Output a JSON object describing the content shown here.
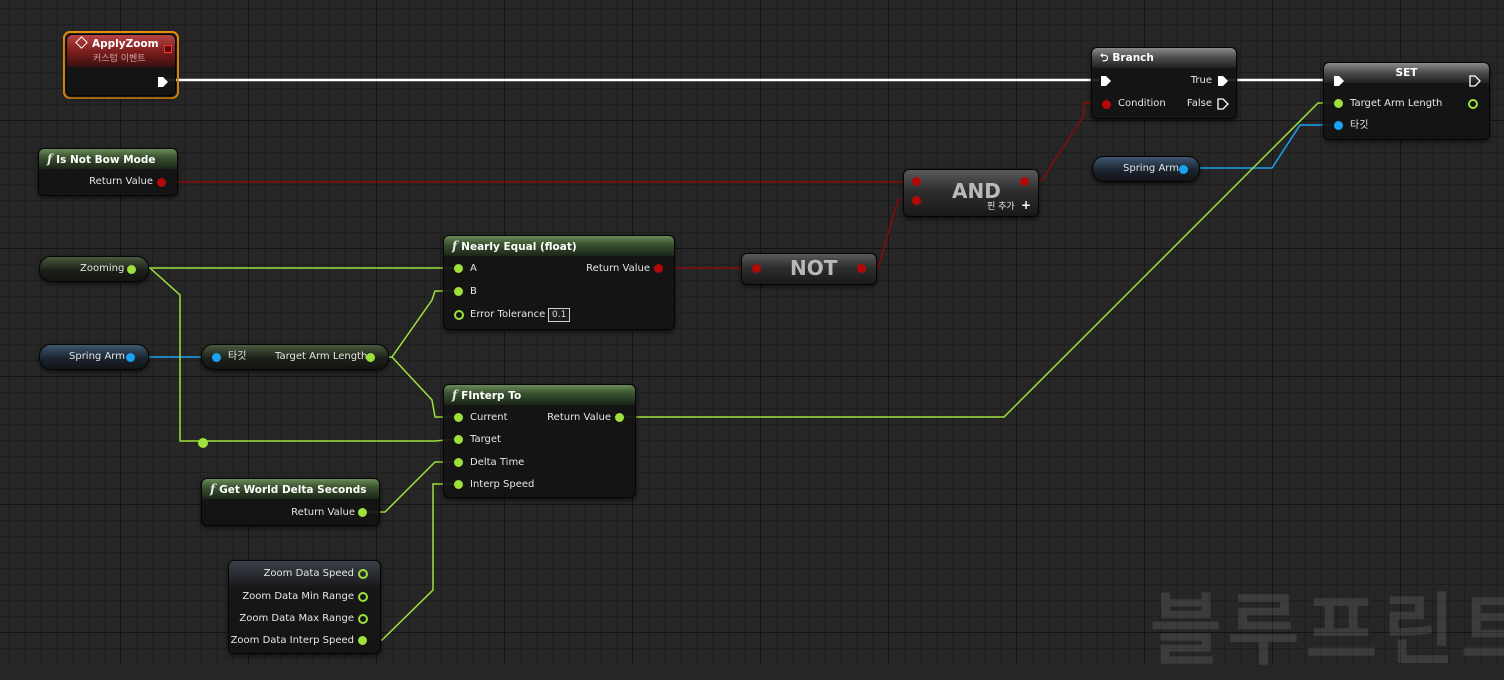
{
  "nodes": {
    "apply_zoom": {
      "title": "ApplyZoom",
      "subtitle": "커스텀 이벤트"
    },
    "branch": {
      "title": "Branch",
      "condition": "Condition",
      "true_label": "True",
      "false_label": "False"
    },
    "set": {
      "title": "SET",
      "target_arm_length": "Target Arm Length",
      "target": "타깃"
    },
    "is_not_bow_mode": {
      "title": "Is Not Bow Mode",
      "return_value": "Return Value"
    },
    "and": {
      "title": "AND",
      "add_pin": "핀 추가"
    },
    "spring_arm_right": {
      "label": "Spring Arm"
    },
    "zooming": {
      "label": "Zooming"
    },
    "nearly_equal": {
      "title": "Nearly Equal (float)",
      "a": "A",
      "b": "B",
      "error_tolerance": "Error Tolerance",
      "error_tolerance_value": "0.1",
      "return_value": "Return Value"
    },
    "not": {
      "title": "NOT"
    },
    "spring_arm_left": {
      "label": "Spring Arm"
    },
    "target_arm_length_get": {
      "target": "타깃",
      "label": "Target Arm Length"
    },
    "finterp_to": {
      "title": "FInterp To",
      "current": "Current",
      "target": "Target",
      "delta_time": "Delta Time",
      "interp_speed": "Interp Speed",
      "return_value": "Return Value"
    },
    "get_world_delta_seconds": {
      "title": "Get World Delta Seconds",
      "return_value": "Return Value"
    },
    "zoom_data": {
      "speed": "Zoom Data Speed",
      "min_range": "Zoom Data Min Range",
      "max_range": "Zoom Data Max Range",
      "interp_speed": "Zoom Data Interp Speed"
    }
  },
  "watermark": "블루프린트",
  "colors": {
    "exec": "#ffffff",
    "float": "#9ee03c",
    "object": "#19a2f2",
    "bool": "#b40808",
    "event_header": "#7e1e1e",
    "function_header": "#3b5431",
    "selection": "#e8900c"
  }
}
